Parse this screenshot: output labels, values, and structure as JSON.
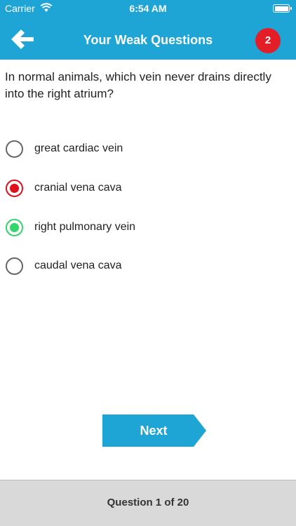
{
  "status_bar": {
    "carrier": "Carrier",
    "time": "6:54 AM"
  },
  "header": {
    "title": "Your Weak Questions",
    "badge_count": "2",
    "color": "#1ea5d6",
    "badge_color": "#e31e26"
  },
  "question": {
    "text": "In normal animals, which vein never drains directly into the right atrium?"
  },
  "options": [
    {
      "label": "great cardiac vein",
      "state": "unselected"
    },
    {
      "label": "cranial vena cava",
      "state": "selected-wrong"
    },
    {
      "label": "right pulmonary vein",
      "state": "correct"
    },
    {
      "label": "caudal vena cava",
      "state": "unselected"
    }
  ],
  "next_button": {
    "label": "Next",
    "color": "#1ea5d6"
  },
  "footer": {
    "progress_text": "Question 1 of 20"
  },
  "colors": {
    "wrong": "#e0111b",
    "correct": "#33d66a"
  },
  "icons": {
    "back": "arrow-left-icon",
    "wifi": "wifi-icon",
    "battery": "battery-icon"
  }
}
